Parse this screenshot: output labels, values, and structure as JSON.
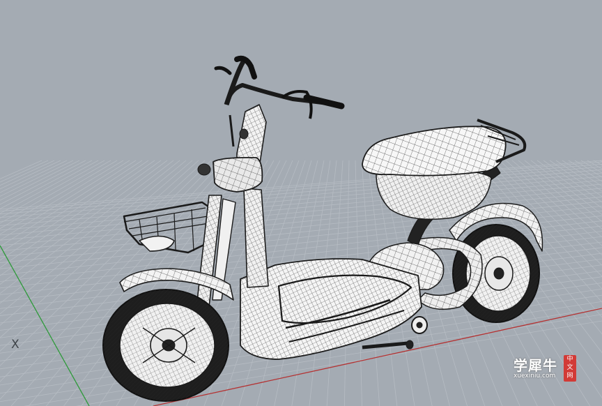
{
  "viewport": {
    "axis_label": "X",
    "background": "#a4abb3",
    "grid_color": "#b6bcc3",
    "x_axis_color": "#b43232",
    "y_axis_color": "#2e9a3a"
  },
  "model": {
    "subject": "electric-scooter-wireframe",
    "wire_color": "#1a1a1a",
    "surface_color": "#f4f4f4"
  },
  "watermark": {
    "brand": "学犀牛",
    "url": "xuexiniu.com",
    "seal_text": "中文网",
    "seal_color": "#d23a36"
  }
}
